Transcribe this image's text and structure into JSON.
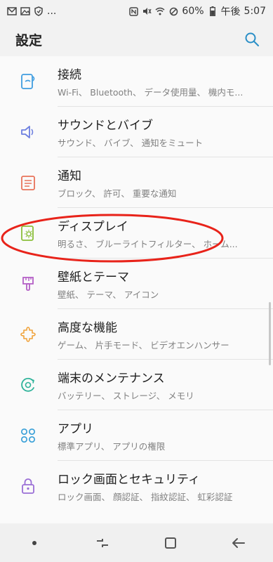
{
  "status": {
    "battery": "60%",
    "ampm": "午後",
    "time": "5:07",
    "overflow": "..."
  },
  "header": {
    "title": "設定"
  },
  "colors": {
    "accent": "#2a8fc7",
    "highlight": "#e8231a"
  },
  "items": [
    {
      "title": "接続",
      "sub": "Wi-Fi、 Bluetooth、 データ使用量、 機内モ...",
      "icon": "connection-icon"
    },
    {
      "title": "サウンドとバイブ",
      "sub": "サウンド、 バイブ、 通知をミュート",
      "icon": "speaker-icon"
    },
    {
      "title": "通知",
      "sub": "ブロック、 許可、 重要な通知",
      "icon": "notification-icon"
    },
    {
      "title": "ディスプレイ",
      "sub": "明るさ、 ブルーライトフィルター、 ホーム...",
      "icon": "display-icon"
    },
    {
      "title": "壁紙とテーマ",
      "sub": "壁紙、 テーマ、 アイコン",
      "icon": "brush-icon"
    },
    {
      "title": "高度な機能",
      "sub": "ゲーム、 片手モード、 ビデオエンハンサー",
      "icon": "puzzle-icon"
    },
    {
      "title": "端末のメンテナンス",
      "sub": "バッテリー、 ストレージ、 メモリ",
      "icon": "maintenance-icon"
    },
    {
      "title": "アプリ",
      "sub": "標準アプリ、 アプリの権限",
      "icon": "apps-icon"
    },
    {
      "title": "ロック画面とセキュリティ",
      "sub": "ロック画面、 顔認証、 指紋認証、 虹彩認証",
      "icon": "lock-icon"
    }
  ]
}
